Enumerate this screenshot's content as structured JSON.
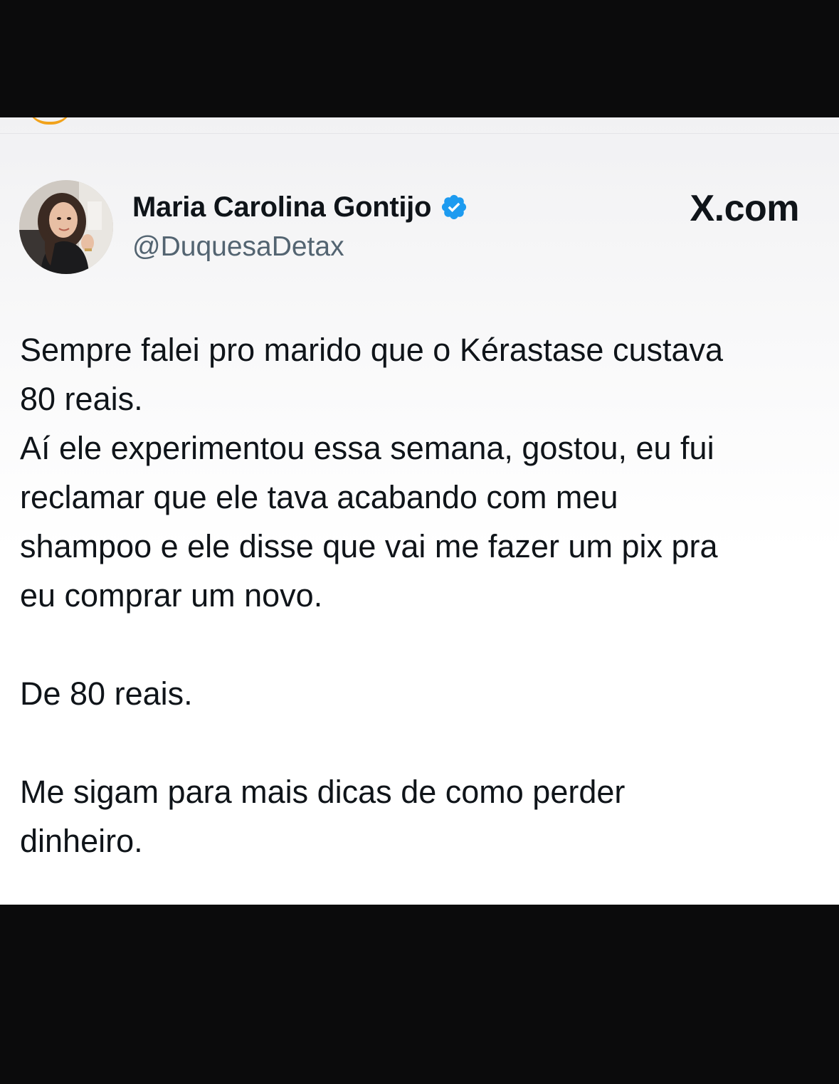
{
  "author": {
    "display_name": "Maria Carolina Gontijo",
    "handle": "@DuquesaDetax",
    "verified": true,
    "verified_badge_color": "#1d9bf0"
  },
  "source_label": "X.com",
  "tweet": {
    "paragraphs": [
      "Sempre falei pro marido que o Kérastase custava\n80 reais.\nAí ele experimentou essa semana, gostou, eu fui\nreclamar que ele tava acabando com meu\nshampoo e ele disse que vai me fazer um pix pra\neu comprar um novo.",
      "De 80 reais.",
      "Me sigam para mais dicas de como perder\ndinheiro."
    ]
  },
  "colors": {
    "text_primary": "#0f1419",
    "text_secondary": "#536471",
    "frame": "#0b0b0c",
    "story_ring": "#f1a21b"
  },
  "icons": {
    "verified": "verified-badge-icon",
    "avatar": "profile-photo"
  }
}
